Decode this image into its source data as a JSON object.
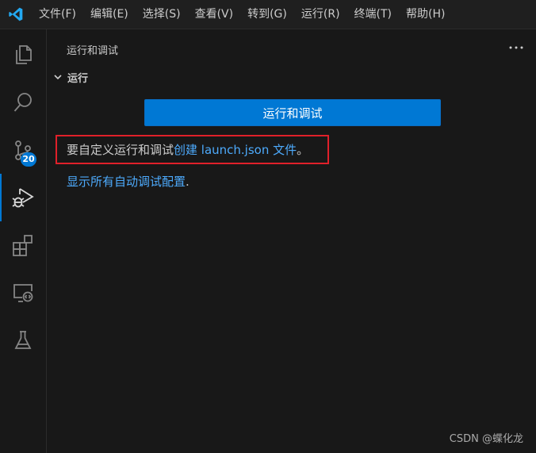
{
  "menu": {
    "items": [
      "文件(F)",
      "编辑(E)",
      "选择(S)",
      "查看(V)",
      "转到(G)",
      "运行(R)",
      "终端(T)",
      "帮助(H)"
    ]
  },
  "activity_bar": {
    "items": [
      {
        "icon": "files-icon"
      },
      {
        "icon": "search-icon"
      },
      {
        "icon": "source-control-icon",
        "badge": "20"
      },
      {
        "icon": "run-debug-icon",
        "active": true
      },
      {
        "icon": "extensions-icon"
      },
      {
        "icon": "remote-explorer-icon"
      },
      {
        "icon": "testing-icon"
      }
    ]
  },
  "sidebar": {
    "title": "运行和调试",
    "section_title": "运行",
    "run_button_label": "运行和调试",
    "info_prefix": "要自定义运行和调试",
    "info_link": "创建 launch.json 文件",
    "info_suffix": "。",
    "show_configs_link": "显示所有自动调试配置",
    "show_configs_suffix": "."
  },
  "watermark": "CSDN @蝶化龙",
  "colors": {
    "accent": "#0078d4",
    "link": "#4daafc",
    "highlight": "#e0202a",
    "background": "#181818"
  }
}
